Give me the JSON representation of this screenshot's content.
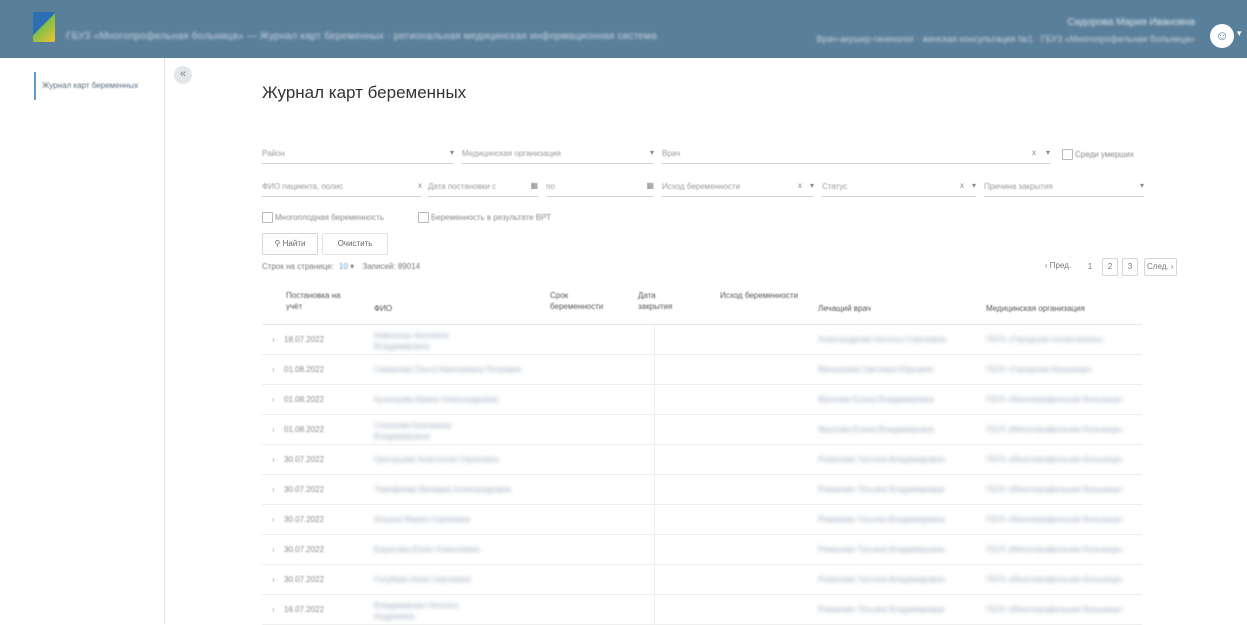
{
  "header": {
    "app_title": "ГБУЗ «Многопрофильная больница» — Журнал карт беременных · региональная медицинская информационная система",
    "user_name": "Сидорова Мария Ивановна",
    "user_role": "Врач-акушер-гинеколог · женская консультация №1 · ГБУЗ «Многопрофильная больница»",
    "avatar_icon": "user-circle-icon",
    "bar_color": "#5a7f9a"
  },
  "sidebar": {
    "items": [
      {
        "label": "Журнал карт беременных",
        "active": true
      }
    ],
    "collapse_icon": "chevron-left-icon"
  },
  "page": {
    "title": "Журнал карт беременных"
  },
  "filters": {
    "region": "Район",
    "med_org": "Медицинская организация",
    "doctor": "Врач",
    "clear_x": "x",
    "caret": "▾",
    "among_pregnant": "Среди умерших",
    "patient_fio": "ФИО пациента, полис",
    "date_from": "Дата постановки с",
    "date_to": "по",
    "outcome": "Исход беременности",
    "status": "Статус",
    "close_reason": "Причина закрытия",
    "multiple_pregnancy": "Многоплодная беременность",
    "ivf_pregnancy": "Беременность в результате ВРТ",
    "search_button": "Найти",
    "clear_button": "Очистить"
  },
  "pagination": {
    "rows_per_page_label": "Строк на странице:",
    "rows_per_page_value": "10",
    "records_label": "Записей:",
    "records_value": "89014",
    "prev": "‹ Пред.",
    "pages": [
      "1",
      "2",
      "3"
    ],
    "next": "След. ›"
  },
  "table": {
    "columns": [
      "Постановка на учёт",
      "ФИО",
      "Срок беременности",
      "Дата закрытия",
      "Исход беременности",
      "Лечащий врач",
      "Медицинская организация"
    ],
    "rows": [
      {
        "date": "18.07.2022",
        "fio": "Ковальчук Ангелина Владимировна",
        "doctor": "Александрова Наталья Сергеевна",
        "org": "ГБУЗ «Городская поликлиника»"
      },
      {
        "date": "01.08.2022",
        "fio": "Смирнова Ольга Николаевна Петровна",
        "doctor": "Малышева Светлана Юрьевна",
        "org": "ГБУЗ «Городская больница»"
      },
      {
        "date": "01.08.2022",
        "fio": "Кузнецова Ирина Александровна",
        "doctor": "Фролова Елена Владимировна",
        "org": "ГБУЗ «Многопрофильная больница»"
      },
      {
        "date": "01.08.2022",
        "fio": "Соколова Екатерина Владимировна",
        "doctor": "Фролова Елена Владимировна",
        "org": "ГБУЗ «Многопрофильная больница»"
      },
      {
        "date": "30.07.2022",
        "fio": "Григорьева Анастасия Сергеевна",
        "doctor": "Романова Татьяна Владимировна",
        "org": "ГБУЗ «Многопрофильная больница»"
      },
      {
        "date": "30.07.2022",
        "fio": "Тимофеева Валерия Александровна",
        "doctor": "Романова Татьяна Владимировна",
        "org": "ГБУЗ «Многопрофильная больница»"
      },
      {
        "date": "30.07.2022",
        "fio": "Ильина Мария Сергеевна",
        "doctor": "Романова Татьяна Владимировна",
        "org": "ГБУЗ «Многопрофильная больница»"
      },
      {
        "date": "30.07.2022",
        "fio": "Борисова Юлия Алексеевна",
        "doctor": "Романова Татьяна Владимировна",
        "org": "ГБУЗ «Многопрофильная больница»"
      },
      {
        "date": "30.07.2022",
        "fio": "Голубева Анна Сергеевна",
        "doctor": "Романова Татьяна Владимировна",
        "org": "ГБУЗ «Многопрофильная больница»"
      },
      {
        "date": "16.07.2022",
        "fio": "Владимирова Наталья Андреевна",
        "doctor": "Романова Татьяна Владимировна",
        "org": "ГБУЗ «Многопрофильная больница»"
      }
    ]
  }
}
